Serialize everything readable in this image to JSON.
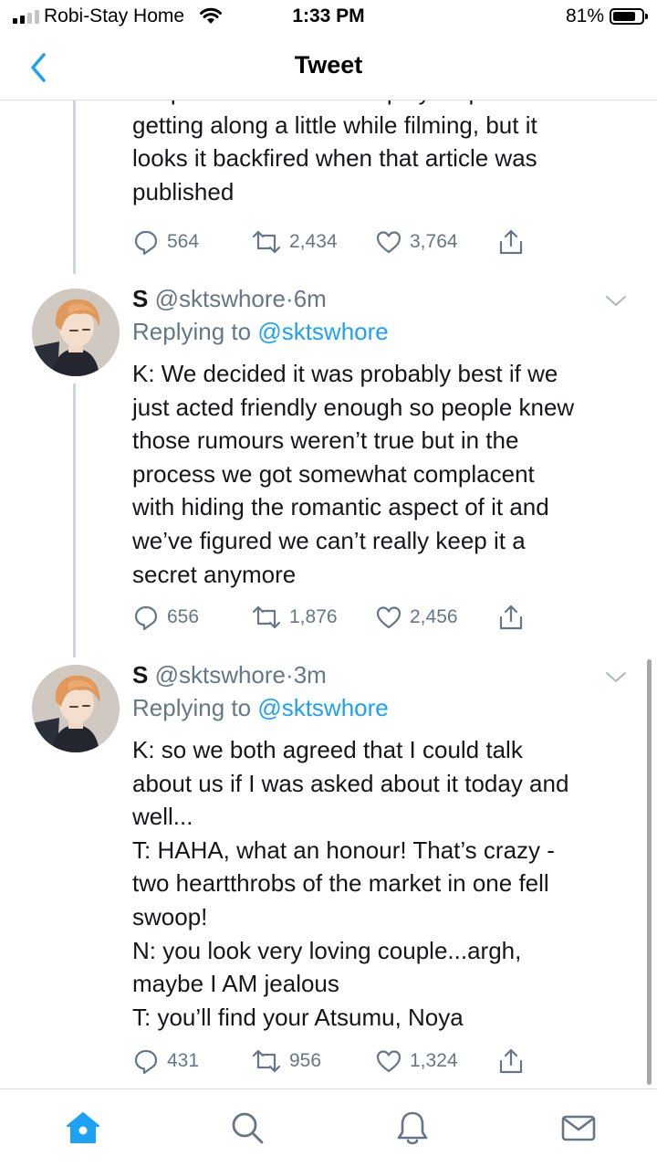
{
  "status_bar": {
    "carrier": "Robi-Stay Home",
    "time": "1:33 PM",
    "battery": "81%",
    "battery_level": 0.81
  },
  "nav": {
    "title": "Tweet",
    "back_icon": "chevron-left-icon"
  },
  "tweets": [
    {
      "text_lines": [
        "wraps so we decided to play it up not",
        "getting along a little while filming, but it",
        "looks it backfired when that article was",
        "published"
      ],
      "actions": {
        "replies": "564",
        "retweets": "2,434",
        "likes": "3,764"
      }
    },
    {
      "name": "S",
      "handle": "@sktswhore",
      "separator": "·",
      "time": "6m",
      "replying_prefix": "Replying to",
      "replying_to": "@sktswhore",
      "text_lines": [
        "K: We decided it was probably best if we",
        "just acted friendly enough so people knew",
        "those rumours weren’t true but in the",
        "process we got somewhat complacent",
        "with hiding the romantic aspect of it and",
        "we’ve figured we can’t really keep it a",
        "secret anymore"
      ],
      "actions": {
        "replies": "656",
        "retweets": "1,876",
        "likes": "2,456"
      }
    },
    {
      "name": "S",
      "handle": "@sktswhore",
      "separator": "·",
      "time": "3m",
      "replying_prefix": "Replying to",
      "replying_to": "@sktswhore",
      "text_lines": [
        "K: so we both agreed that I could talk",
        "about us if I was asked about it today and",
        "well...",
        "T: HAHA, what an honour! That’s crazy -",
        "two heartthrobs of the market in one fell",
        "swoop!",
        "N: you look very loving couple...argh,",
        "maybe I AM jealous",
        "T: you’ll find your Atsumu, Noya"
      ],
      "actions": {
        "replies": "431",
        "retweets": "956",
        "likes": "1,324"
      }
    }
  ],
  "tab_bar": {
    "items": [
      "home-icon",
      "search-icon",
      "notifications-bell-icon",
      "messages-mail-icon"
    ],
    "active": "home-icon",
    "accent_color": "#1da1f2"
  },
  "colors": {
    "accent": "#1da1f2",
    "secondary_text": "#657786",
    "primary_text": "#14171a",
    "divider": "#ccd6dd"
  }
}
